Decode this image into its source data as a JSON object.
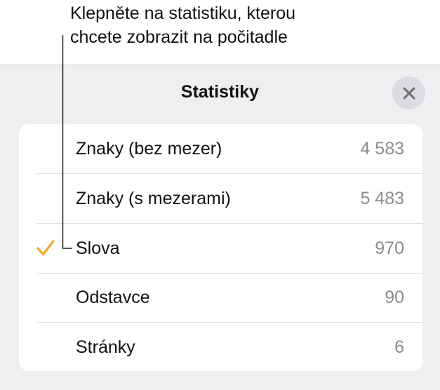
{
  "callout": {
    "line1": "Klepněte na statistiku, kterou",
    "line2": "chcete zobrazit na počitadle"
  },
  "panel": {
    "title": "Statistiky",
    "close_icon": "close-icon"
  },
  "stats": [
    {
      "label": "Znaky (bez mezer)",
      "value": "4 583",
      "selected": false
    },
    {
      "label": "Znaky (s mezerami)",
      "value": "5 483",
      "selected": false
    },
    {
      "label": "Slova",
      "value": "970",
      "selected": true
    },
    {
      "label": "Odstavce",
      "value": "90",
      "selected": false
    },
    {
      "label": "Stránky",
      "value": "6",
      "selected": false
    }
  ],
  "colors": {
    "accent": "#f5a623",
    "panel_bg": "#efeff1",
    "secondary_text": "#8c8c8c"
  },
  "icons": {
    "selected": "checkmark-icon"
  }
}
